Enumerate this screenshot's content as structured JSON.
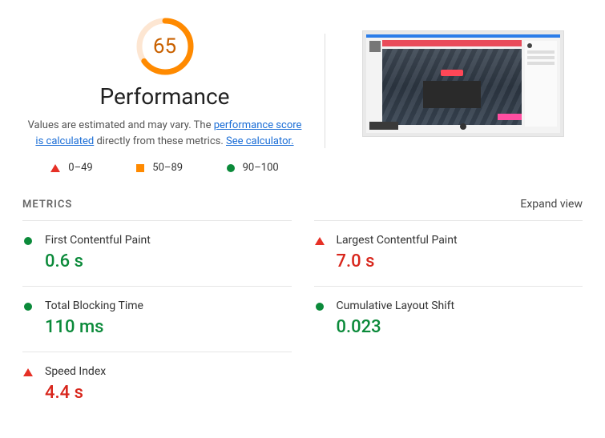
{
  "score": {
    "value": "65",
    "percent": 65,
    "title": "Performance",
    "desc_prefix": "Values are estimated and may vary. The ",
    "desc_link1": "performance score is calculated",
    "desc_mid": " directly from these metrics. ",
    "desc_link2": "See calculator."
  },
  "legend": {
    "poor": "0–49",
    "mid": "50–89",
    "good": "90–100"
  },
  "metrics_section": {
    "title": "METRICS",
    "expand": "Expand view"
  },
  "metrics": {
    "fcp": {
      "name": "First Contentful Paint",
      "value": "0.6 s",
      "status": "good"
    },
    "lcp": {
      "name": "Largest Contentful Paint",
      "value": "7.0 s",
      "status": "poor"
    },
    "tbt": {
      "name": "Total Blocking Time",
      "value": "110 ms",
      "status": "good"
    },
    "cls": {
      "name": "Cumulative Layout Shift",
      "value": "0.023",
      "status": "good"
    },
    "si": {
      "name": "Speed Index",
      "value": "4.4 s",
      "status": "poor"
    }
  }
}
